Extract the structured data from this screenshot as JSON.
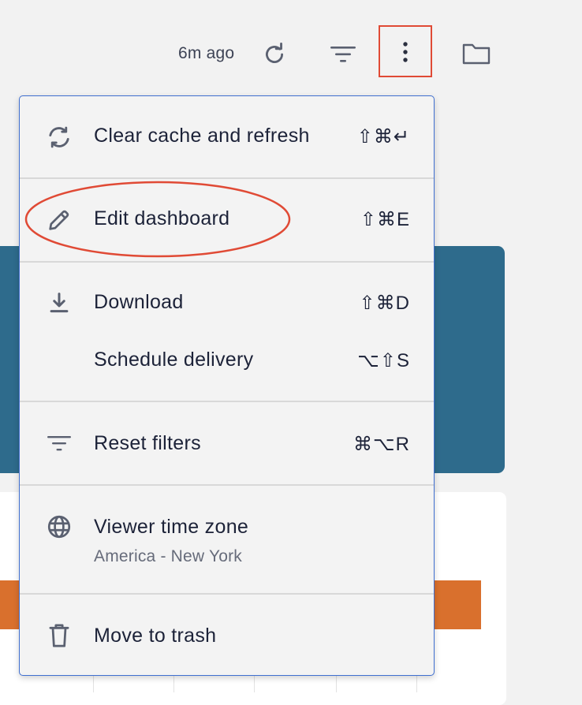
{
  "toolbar": {
    "last_updated": "6m ago",
    "icons": [
      "refresh-icon",
      "filter-icon",
      "more-vertical-icon",
      "folder-icon"
    ],
    "highlight_color": "#e04a35"
  },
  "menu": {
    "clear_cache": {
      "label": "Clear cache and refresh",
      "shortcut": "⇧⌘↵",
      "icon": "sync-icon"
    },
    "edit_dashboard": {
      "label": "Edit dashboard",
      "shortcut": "⇧⌘E",
      "icon": "pencil-icon"
    },
    "download": {
      "label": "Download",
      "shortcut": "⇧⌘D",
      "icon": "download-icon"
    },
    "schedule_delivery": {
      "label": "Schedule delivery",
      "shortcut": "⌥⇧S"
    },
    "reset_filters": {
      "label": "Reset filters",
      "shortcut": "⌘⌥R",
      "icon": "filter-icon"
    },
    "viewer_time_zone": {
      "label": "Viewer time zone",
      "sublabel": "America - New York",
      "icon": "globe-icon"
    },
    "move_to_trash": {
      "label": "Move to trash",
      "icon": "trash-icon"
    }
  },
  "colors": {
    "menu_border": "#3f6fd0",
    "tile_blue": "#2e6b8c",
    "bar_orange": "#d9702d"
  }
}
